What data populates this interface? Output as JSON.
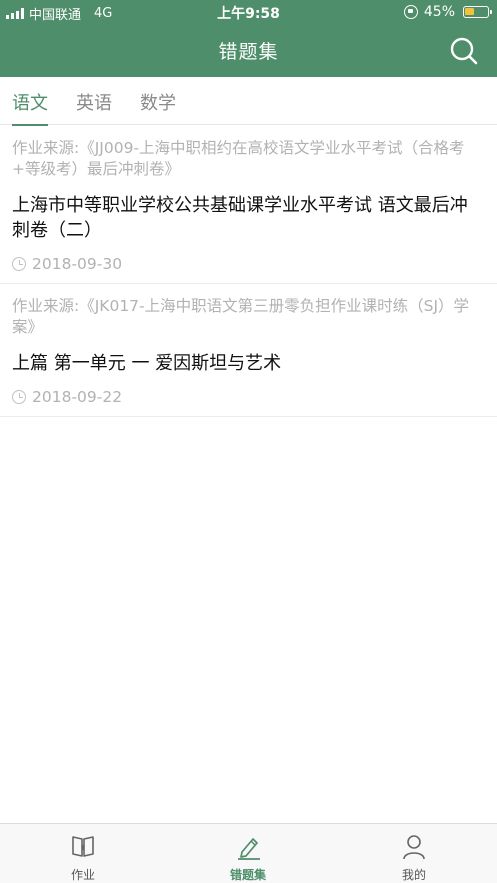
{
  "status_bar": {
    "carrier": "中国联通",
    "network": "4G",
    "time": "上午9:58",
    "battery_text": "45%",
    "battery_level": 0.45
  },
  "header": {
    "title": "错题集",
    "search_icon": "search-icon"
  },
  "tabs": [
    {
      "label": "语文",
      "active": true
    },
    {
      "label": "英语",
      "active": false
    },
    {
      "label": "数学",
      "active": false
    }
  ],
  "items": [
    {
      "source": "作业来源:《JJ009-上海中职相约在高校语文学业水平考试（合格考+等级考）最后冲刺卷》",
      "title": "上海市中等职业学校公共基础课学业水平考试 语文最后冲刺卷（二）",
      "date": "2018-09-30"
    },
    {
      "source": "作业来源:《JK017-上海中职语文第三册零负担作业课时练（SJ）学案》",
      "title": "上篇 第一单元 一 爱因斯坦与艺术",
      "date": "2018-09-22"
    }
  ],
  "bottom_nav": [
    {
      "label": "作业",
      "icon": "book-icon",
      "active": false
    },
    {
      "label": "错题集",
      "icon": "pencil-icon",
      "active": true
    },
    {
      "label": "我的",
      "icon": "person-icon",
      "active": false
    }
  ],
  "colors": {
    "brand_green": "#4e8e6a",
    "battery_yellow": "#f3c23d"
  }
}
